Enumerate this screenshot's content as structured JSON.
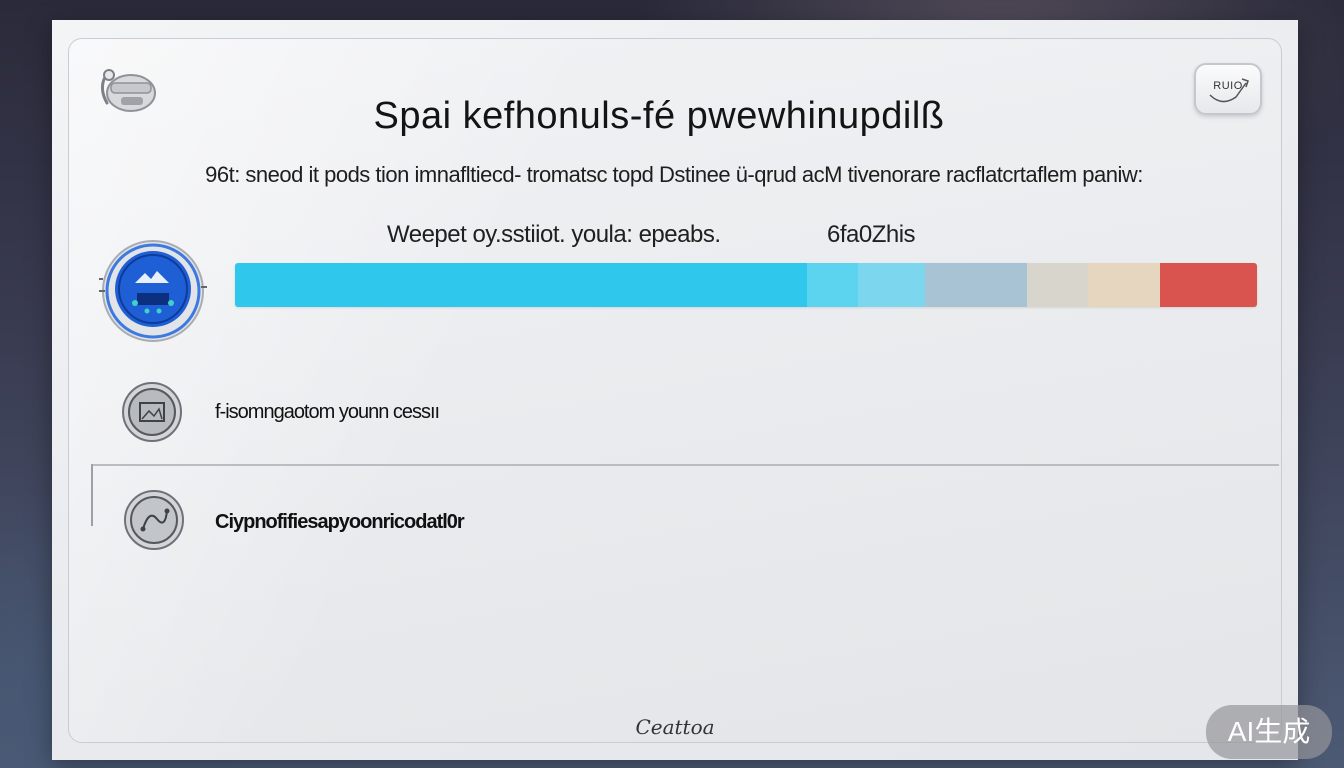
{
  "window": {
    "title": "Spai kefhonuls-fé pwewhinupdilß",
    "subtitle": "96t: sneod it pods tion imnafltiecd- tromatsc topd Dstinee ü-qrud acM tivenorare racflatcrtaflem paniw:",
    "close_button_label": "RUIO"
  },
  "status": {
    "text": "Weepet oy.sstiiot. youla: epeabs.",
    "value": "6fa0Zhis"
  },
  "progress": {
    "fill_fraction": 0.56,
    "segments": [
      {
        "start": 0.56,
        "end": 0.61,
        "color": "#5dd4ef"
      },
      {
        "start": 0.61,
        "end": 0.675,
        "color": "#7bd6ee"
      },
      {
        "start": 0.675,
        "end": 0.775,
        "color": "#a8c4d4"
      },
      {
        "start": 0.775,
        "end": 0.835,
        "color": "#d8d6cc"
      },
      {
        "start": 0.835,
        "end": 0.905,
        "color": "#e6d6bf"
      },
      {
        "start": 0.905,
        "end": 1.0,
        "color": "#d9534f"
      }
    ],
    "fill_color": "#2fc8ec"
  },
  "options": [
    {
      "label": "f-isomngaotom younn cessıı",
      "icon": "gallery-coin-icon"
    },
    {
      "label": "Ciypnofifiesapyoonricodatl0r",
      "icon": "route-coin-icon"
    }
  ],
  "footer": {
    "text": "Ceattoa"
  },
  "watermark": {
    "text": "AI生成"
  },
  "colors": {
    "accent": "#2fc8ec",
    "badge_blue": "#1f5fd6",
    "danger": "#d9534f"
  }
}
